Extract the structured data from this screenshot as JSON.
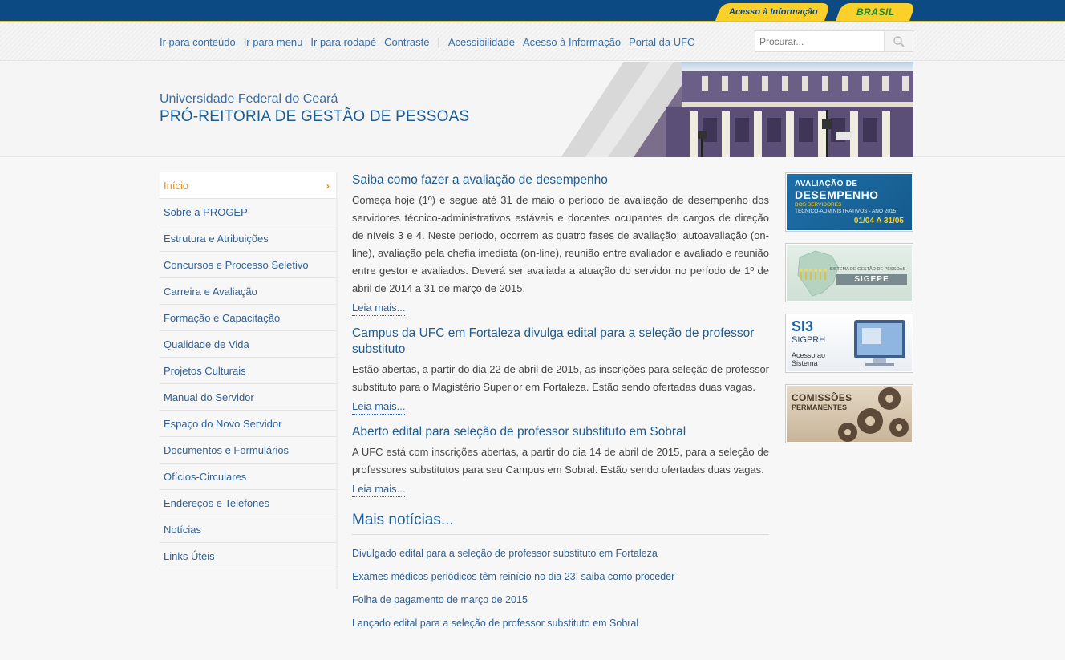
{
  "gov_bar": {
    "access_info_label": "Acesso à Informação",
    "brasil_label": "BRASIL"
  },
  "accessibility": {
    "links": [
      "Ir para conteúdo",
      "Ir para menu",
      "Ir para rodapé",
      "Contraste",
      "Acessibilidade",
      "Acesso à Informação",
      "Portal da UFC"
    ],
    "search_placeholder": "Procurar..."
  },
  "header": {
    "university": "Universidade Federal do Ceará",
    "department": "PRÓ-REITORIA DE GESTÃO DE PESSOAS"
  },
  "sidebar": {
    "items": [
      {
        "label": "Início",
        "active": true
      },
      {
        "label": "Sobre a PROGEP"
      },
      {
        "label": "Estrutura e Atribuições"
      },
      {
        "label": "Concursos e Processo Seletivo"
      },
      {
        "label": "Carreira e Avaliação"
      },
      {
        "label": "Formação e Capacitação"
      },
      {
        "label": "Qualidade de Vida"
      },
      {
        "label": "Projetos Culturais"
      },
      {
        "label": "Manual do Servidor"
      },
      {
        "label": "Espaço do Novo Servidor"
      },
      {
        "label": "Documentos e Formulários"
      },
      {
        "label": "Ofícios-Circulares"
      },
      {
        "label": "Endereços e Telefones"
      },
      {
        "label": "Notícias"
      },
      {
        "label": "Links Úteis"
      }
    ]
  },
  "news": [
    {
      "title": "Saiba como fazer a avaliação de desempenho",
      "body": "Começa hoje (1º) e segue até 31 de maio o período de avaliação de desempenho dos servidores técnico-administrativos estáveis e docentes ocupantes de cargos de direção de níveis 3 e 4. Neste período, ocorrem as quatro fases de avaliação: autoavaliação (on-line), avaliação pela chefia imediata (on-line), reunião entre avaliador e avaliado e reunião entre gestor e avaliados. Deverá ser avaliada a atuação do servidor no período de 1º de abril de 2014 a 31 de março de 2015.",
      "more": "Leia mais..."
    },
    {
      "title": "Campus da UFC em Fortaleza divulga edital para a seleção de professor substituto",
      "body": "Estão abertas, a partir do dia 22 de abril de 2015, as inscrições para seleção de professor substituto para o Magistério Superior em Fortaleza. Estão sendo ofertadas duas vagas.",
      "more": "Leia mais..."
    },
    {
      "title": "Aberto edital para seleção de professor substituto em Sobral",
      "body": "A UFC está com inscrições abertas, a partir do dia 14 de abril de 2015, para a seleção de professores substitutos para seu Campus em Sobral. Estão sendo ofertadas duas vagas.",
      "more": "Leia mais..."
    }
  ],
  "mais_noticias": {
    "title": "Mais notícias...",
    "items": [
      "Divulgado edital para a seleção de professor substituto em Fortaleza",
      "Exames médicos periódicos têm reinício no dia 23; saiba como proceder",
      "Folha de pagamento de março de 2015",
      "Lançado edital para a seleção de professor substituto em Sobral"
    ]
  },
  "banners": {
    "avaliacao": {
      "line1": "AVALIAÇÃO DE",
      "line2": "DESEMPENHO",
      "line3": "DOS SERVIDORES",
      "line4": "TÉCNICO-ADMINISTRATIVOS - ANO 2015",
      "dates": "01/04 A 31/05"
    },
    "sigepe": {
      "caption": "SISTEMA DE GESTÃO DE PESSOAS",
      "name": "SIGEPE"
    },
    "si3": {
      "title": "SI3",
      "subtitle": "SIGPRH",
      "access": "Acesso ao Sistema"
    },
    "comissoes": {
      "title": "COMISSÕES",
      "subtitle": "PERMANENTES"
    }
  }
}
